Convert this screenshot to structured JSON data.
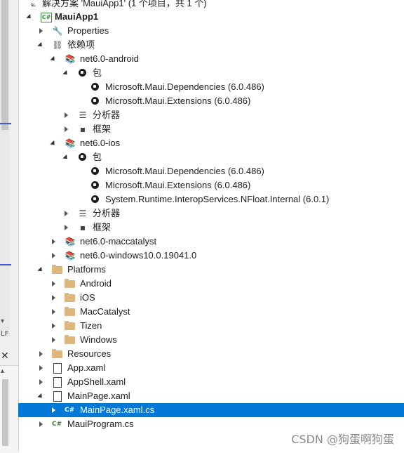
{
  "solution_row": {
    "label": "解决方案 'MauiApp1' (1 个项目，共 1 个)"
  },
  "project": {
    "label": "MauiApp1",
    "icon": "csharp-project-icon"
  },
  "rows": [
    {
      "label": "Properties"
    },
    {
      "label": "依赖项"
    },
    {
      "label": "net6.0-android"
    },
    {
      "label": "包"
    },
    {
      "label": "Microsoft.Maui.Dependencies (6.0.486)"
    },
    {
      "label": "Microsoft.Maui.Extensions (6.0.486)"
    },
    {
      "label": "分析器"
    },
    {
      "label": "框架"
    },
    {
      "label": "net6.0-ios"
    },
    {
      "label": "包"
    },
    {
      "label": "Microsoft.Maui.Dependencies (6.0.486)"
    },
    {
      "label": "Microsoft.Maui.Extensions (6.0.486)"
    },
    {
      "label": "System.Runtime.InteropServices.NFloat.Internal (6.0.1)"
    },
    {
      "label": "分析器"
    },
    {
      "label": "框架"
    },
    {
      "label": "net6.0-maccatalyst"
    },
    {
      "label": "net6.0-windows10.0.19041.0"
    },
    {
      "label": "Platforms"
    },
    {
      "label": "Android"
    },
    {
      "label": "iOS"
    },
    {
      "label": "MacCatalyst"
    },
    {
      "label": "Tizen"
    },
    {
      "label": "Windows"
    },
    {
      "label": "Resources"
    },
    {
      "label": "App.xaml"
    },
    {
      "label": "AppShell.xaml"
    },
    {
      "label": "MainPage.xaml"
    },
    {
      "label": "MainPage.xaml.cs"
    },
    {
      "label": "MauiProgram.cs"
    }
  ],
  "csharp_badge": "C#",
  "left_pane": {
    "tiny_text": "LF"
  },
  "watermark": "CSDN @狗蛋啊狗蛋",
  "colors": {
    "selection": "#0078d7",
    "folder": "#dcb67a",
    "csharp": "#388a34",
    "solution": "#68217a"
  }
}
